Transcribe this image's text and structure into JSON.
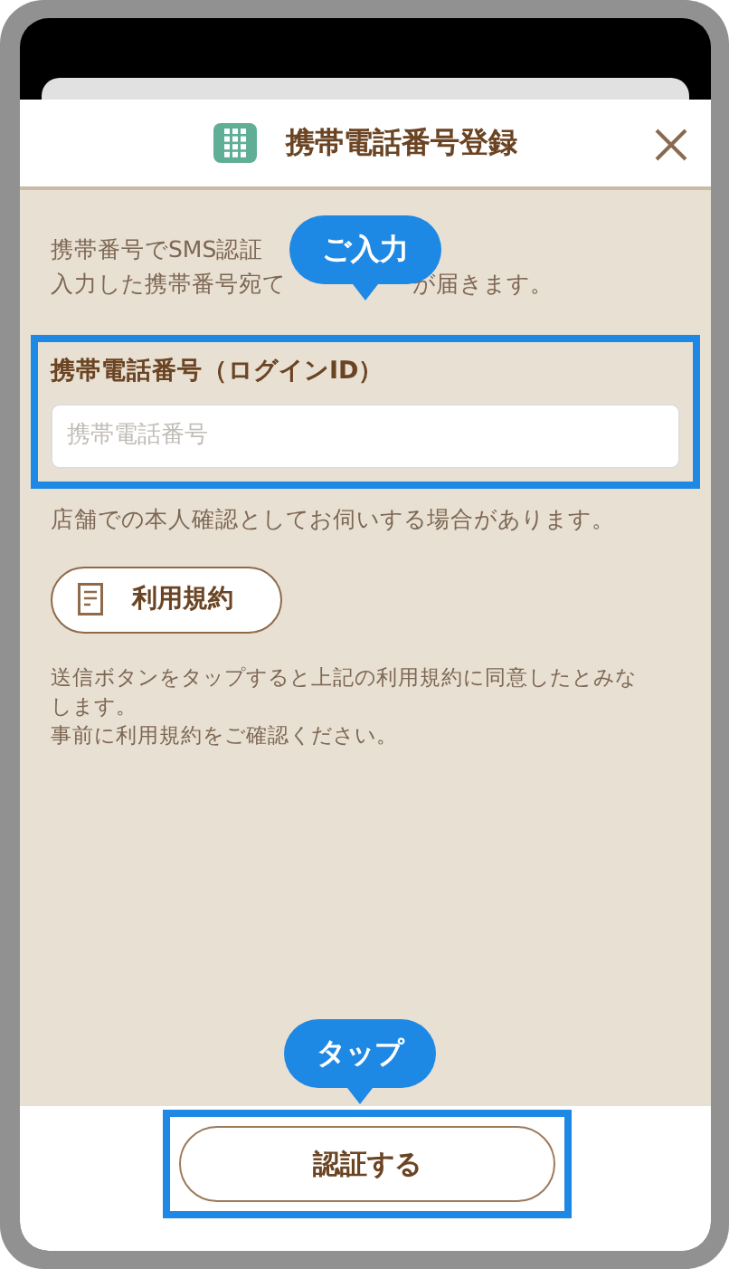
{
  "modal": {
    "title": "携帯電話番号登録"
  },
  "intro": {
    "line_1": "携帯番号でSMS認証",
    "line_2_start": "入力した携帯番号宛て",
    "line_2_end": "が届きます。"
  },
  "callouts": [
    {
      "text": "ご入力"
    },
    {
      "text": "タップ"
    }
  ],
  "phone_field": {
    "label": "携帯電話番号（ログインID）",
    "placeholder": "携帯電話番号"
  },
  "note": "店舗での本人確認としてお伺いする場合があります。",
  "terms_button": {
    "label": "利用規約"
  },
  "agreement": [
    "送信ボタンをタップすると上記の利用規約に同意したとみなします。",
    "事前に利用規約をご確認ください。"
  ],
  "submit_button": {
    "label": "認証する"
  }
}
